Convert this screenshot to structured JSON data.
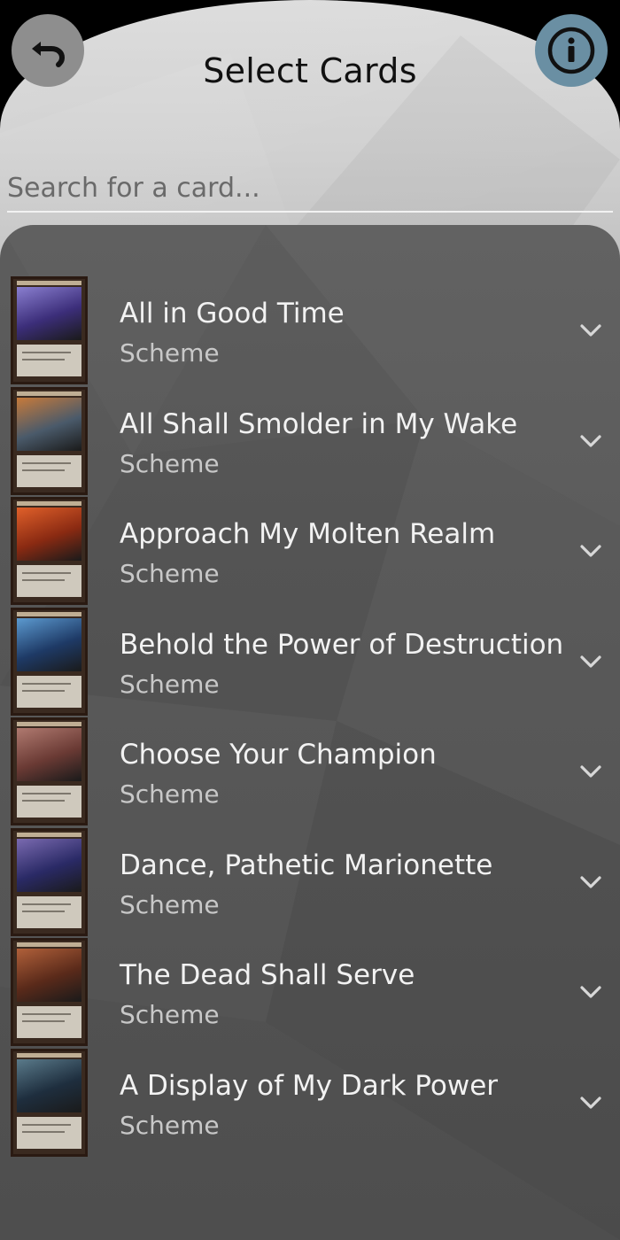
{
  "header": {
    "title": "Select Cards",
    "back_icon": "undo-arrow-icon",
    "info_icon": "info-circle-icon"
  },
  "search": {
    "placeholder": "Search for a card...",
    "value": ""
  },
  "cards": [
    {
      "name": "All in Good Time",
      "type": "Scheme",
      "art": [
        "#3c2e7a",
        "#8a7fd0"
      ]
    },
    {
      "name": "All Shall Smolder in My Wake",
      "type": "Scheme",
      "art": [
        "#4a5a6a",
        "#c77a3a"
      ]
    },
    {
      "name": "Approach My Molten Realm",
      "type": "Scheme",
      "art": [
        "#8a2a12",
        "#e0602a"
      ]
    },
    {
      "name": "Behold the Power of Destruction",
      "type": "Scheme",
      "art": [
        "#1e3a66",
        "#5c9ad0"
      ]
    },
    {
      "name": "Choose Your Champion",
      "type": "Scheme",
      "art": [
        "#6a3a34",
        "#b07a70"
      ]
    },
    {
      "name": "Dance, Pathetic Marionette",
      "type": "Scheme",
      "art": [
        "#2a2a66",
        "#7a6ab0"
      ]
    },
    {
      "name": "The Dead Shall Serve",
      "type": "Scheme",
      "art": [
        "#5a2a1a",
        "#b0603a"
      ]
    },
    {
      "name": "A Display of My Dark Power",
      "type": "Scheme",
      "art": [
        "#1e2e3e",
        "#5a7a8a"
      ]
    }
  ],
  "colors": {
    "info_button": "#6a8fa3",
    "back_button": "#8e8e8e",
    "list_background": "#575757"
  }
}
